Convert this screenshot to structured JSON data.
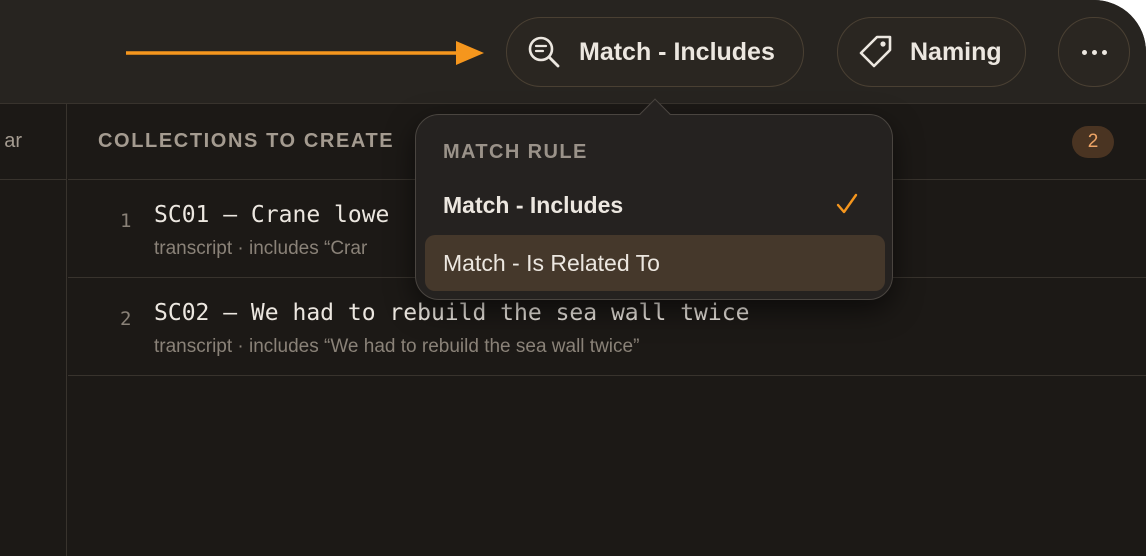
{
  "toolbar": {
    "match_button_label": "Match - Includes",
    "naming_button_label": "Naming",
    "arrow_color": "#f5961d"
  },
  "sidebar": {
    "header_label": "ar"
  },
  "main": {
    "header_title": "COLLECTIONS TO CREATE",
    "count": "2",
    "rows": [
      {
        "num": "1",
        "name": "SC01 – Crane lowe",
        "detail": "transcript · includes “Crar"
      },
      {
        "num": "2",
        "name": "SC02 – We had to rebuild the sea wall twice",
        "detail": "transcript · includes “We had to rebuild the sea wall twice”"
      }
    ]
  },
  "dropdown": {
    "title": "MATCH RULE",
    "options": [
      {
        "label": "Match - Includes",
        "selected": true
      },
      {
        "label": "Match - Is Related To",
        "selected": false
      }
    ]
  },
  "icons": {
    "match": "search-list-icon",
    "naming": "tag-icon",
    "more": "ellipsis-icon",
    "check": "checkmark-icon"
  },
  "colors": {
    "accent": "#f5961d",
    "badge_bg": "#4a3422",
    "badge_text": "#eea466"
  }
}
